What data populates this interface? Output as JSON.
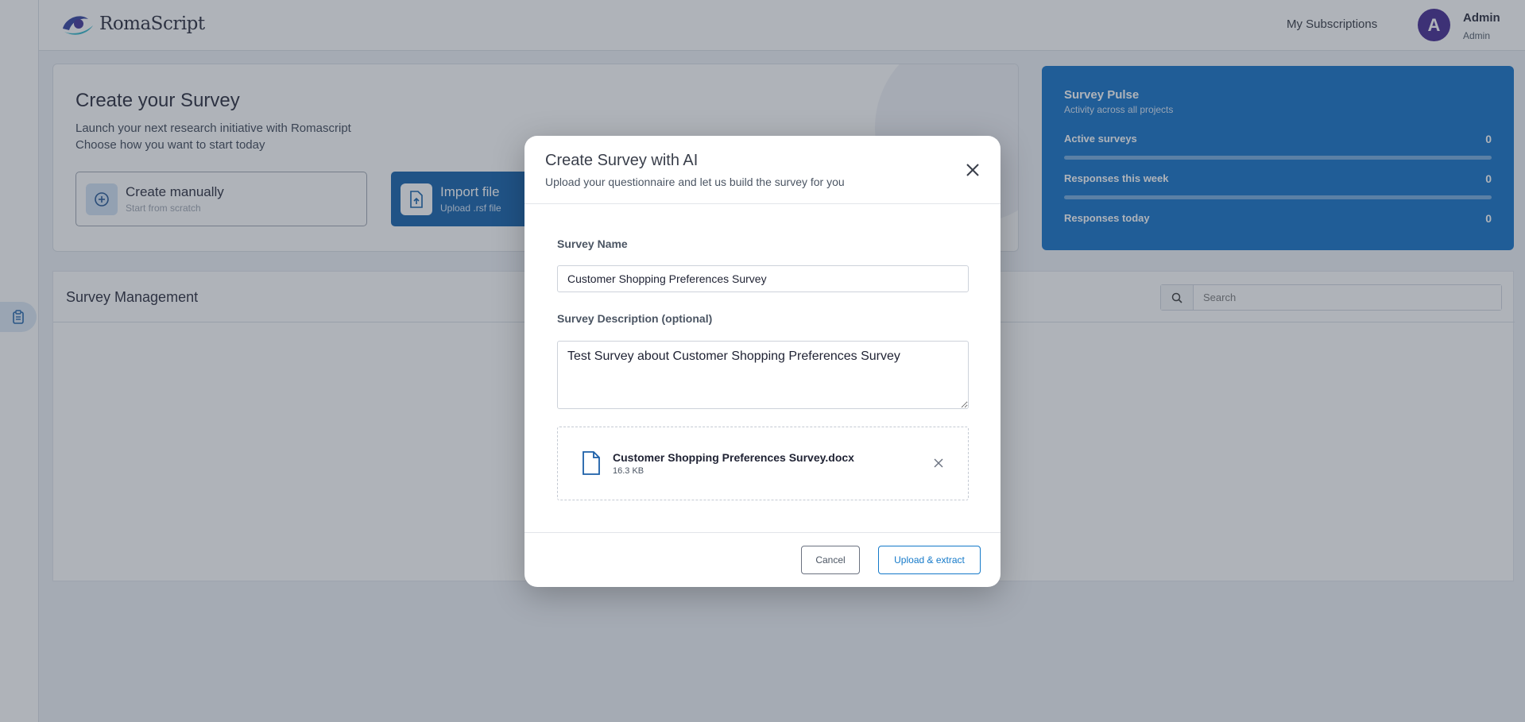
{
  "brand": {
    "name": "RomaScript"
  },
  "header": {
    "nav_link": "My Subscriptions",
    "user": {
      "initial": "A",
      "name": "Admin",
      "role": "Admin"
    }
  },
  "create": {
    "title": "Create your Survey",
    "line1": "Launch your next research initiative with Romascript",
    "line2": "Choose how you want to start today",
    "manual": {
      "title": "Create manually",
      "subtitle": "Start from scratch",
      "icon": "plus-circle-icon"
    },
    "import": {
      "title": "Import file",
      "subtitle": "Upload .rsf file",
      "icon": "file-upload-icon"
    }
  },
  "pulse": {
    "title": "Survey Pulse",
    "subtitle": "Activity across all projects",
    "rows": [
      {
        "label": "Active surveys",
        "value": "0"
      },
      {
        "label": "Responses this week",
        "value": "0"
      },
      {
        "label": "Responses today",
        "value": "0"
      }
    ]
  },
  "management": {
    "title": "Survey Management",
    "search_placeholder": "Search",
    "search_value": ""
  },
  "sidebar": {
    "items": [
      {
        "icon": "clipboard-icon"
      }
    ]
  },
  "modal": {
    "title": "Create Survey with AI",
    "subtitle": "Upload your questionnaire and let us build the survey for you",
    "name_label": "Survey Name",
    "name_value": "Customer Shopping Preferences Survey",
    "desc_label": "Survey Description (optional)",
    "desc_value": "Test Survey about Customer Shopping Preferences Survey",
    "file": {
      "name": "Customer Shopping Preferences Survey.docx",
      "size": "16.3 KB"
    },
    "cancel_label": "Cancel",
    "upload_label": "Upload & extract"
  },
  "colors": {
    "primary": "#0a5ba8",
    "pulse_bg": "#0a6bc4",
    "avatar_bg": "#3b1f8c",
    "accent_button": "#1479c9"
  }
}
